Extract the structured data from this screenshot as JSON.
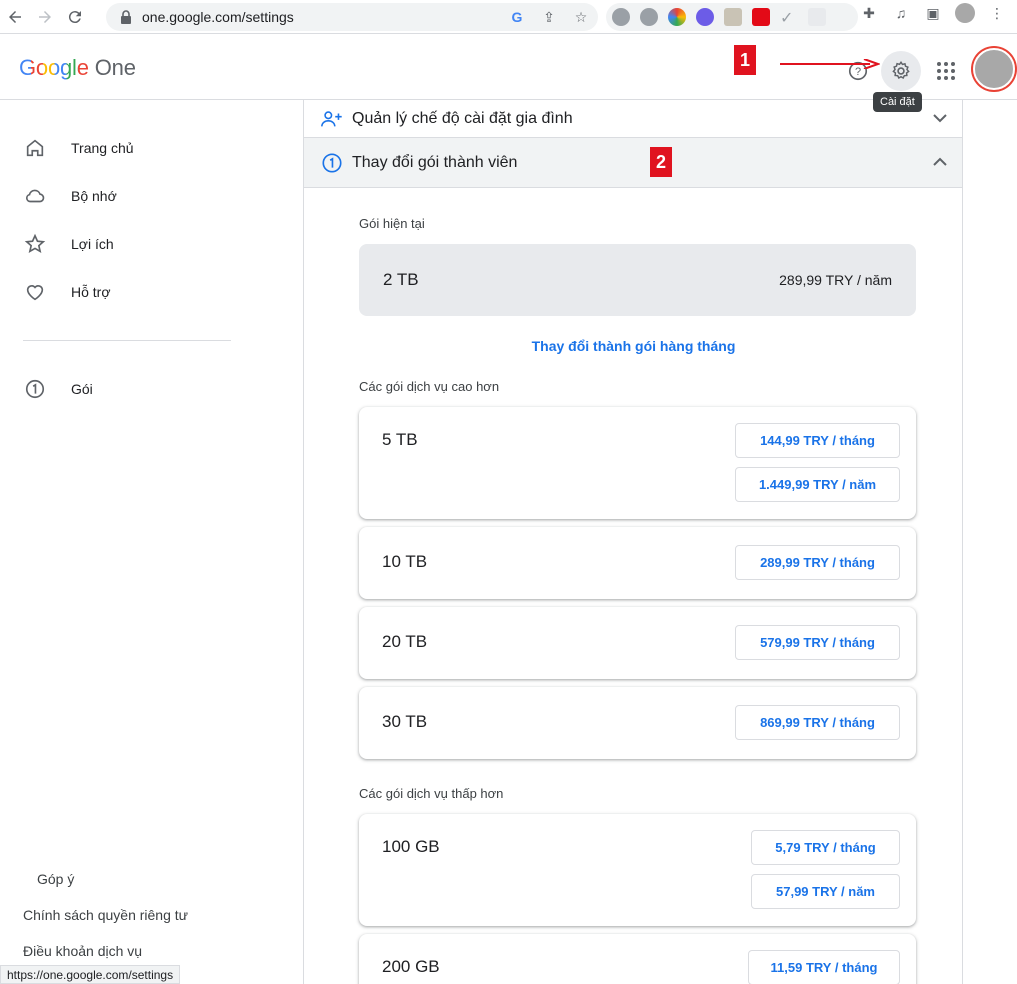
{
  "browser": {
    "url": "one.google.com/settings",
    "status_url": "https://one.google.com/settings",
    "ext_badge": "TO3"
  },
  "header": {
    "logo_google": "Google",
    "logo_one": "One",
    "tooltip": "Cài đặt",
    "icons": [
      "help-icon",
      "gear-icon",
      "apps-icon"
    ]
  },
  "annotations": {
    "marker1": "1",
    "marker2": "2",
    "color": "#e0131f"
  },
  "sidebar": {
    "items": [
      {
        "label": "Trang chủ",
        "icon": "home-icon"
      },
      {
        "label": "Bộ nhớ",
        "icon": "cloud-icon"
      },
      {
        "label": "Lợi ích",
        "icon": "star-icon"
      },
      {
        "label": "Hỗ trợ",
        "icon": "heart-icon"
      },
      {
        "label": "Gói",
        "icon": "plan-one-icon"
      }
    ],
    "footer": [
      "Góp ý",
      "Chính sách quyền riêng tư",
      "Điều khoản dịch vụ"
    ]
  },
  "main": {
    "family_settings": "Quản lý chế độ cài đặt gia đình",
    "change_plan": "Thay đổi gói thành viên",
    "current_label": "Gói hiện tại",
    "current_size": "2 TB",
    "current_price": "289,99 TRY / năm",
    "switch_monthly": "Thay đổi thành gói hàng tháng",
    "higher_label": "Các gói dịch vụ cao hơn",
    "lower_label": "Các gói dịch vụ thấp hơn",
    "higher_plans": [
      {
        "size": "5 TB",
        "monthly": "144,99 TRY / tháng",
        "yearly": "1.449,99 TRY / năm"
      },
      {
        "size": "10 TB",
        "monthly": "289,99 TRY / tháng"
      },
      {
        "size": "20 TB",
        "monthly": "579,99 TRY / tháng"
      },
      {
        "size": "30 TB",
        "monthly": "869,99 TRY / tháng"
      }
    ],
    "lower_plans": [
      {
        "size": "100 GB",
        "monthly": "5,79 TRY / tháng",
        "yearly": "57,99 TRY / năm"
      },
      {
        "size": "200 GB",
        "monthly": "11,59 TRY / tháng"
      }
    ]
  },
  "colors": {
    "accent": "#1a73e8",
    "surface": "#f1f3f4"
  }
}
